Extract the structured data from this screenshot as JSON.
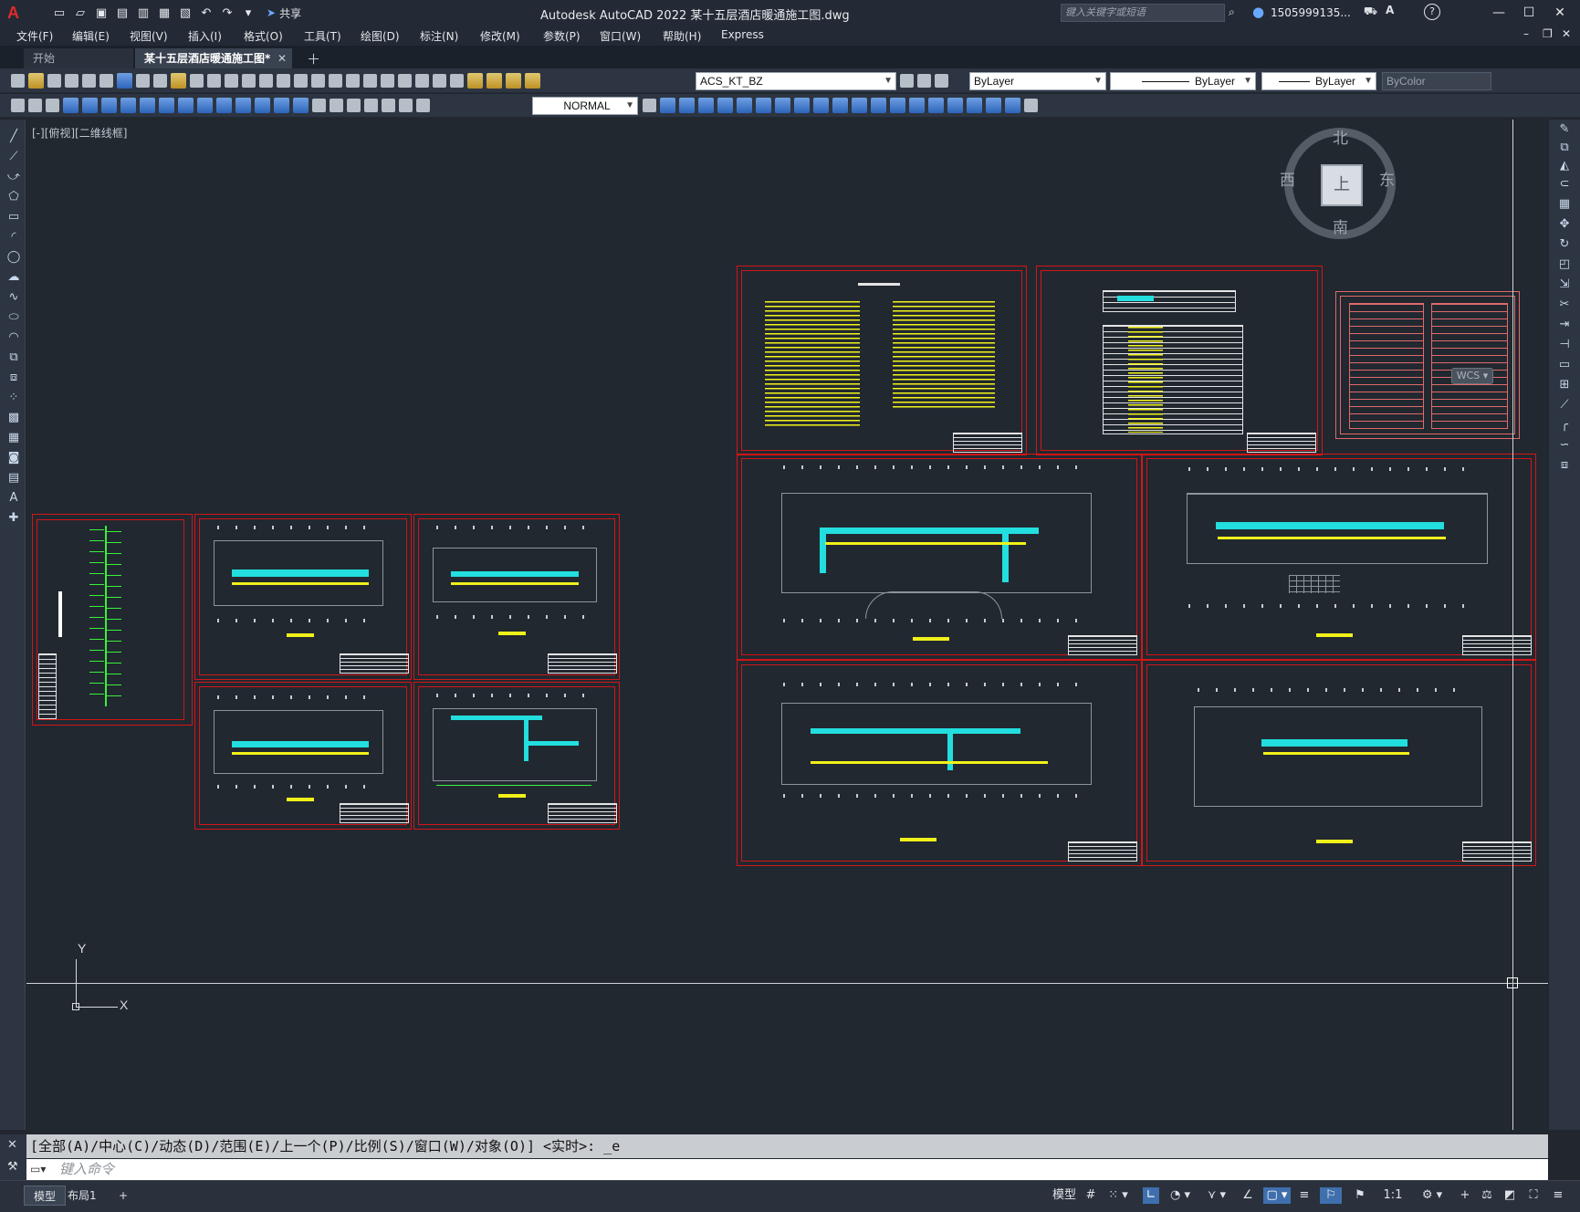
{
  "app": {
    "title": "Autodesk AutoCAD 2022    某十五层酒店暖通施工图.dwg",
    "share_label": "共享",
    "search_placeholder": "键入关键字或短语",
    "user_name": "1505999135..."
  },
  "menu": [
    "文件(F)",
    "编辑(E)",
    "视图(V)",
    "插入(I)",
    "格式(O)",
    "工具(T)",
    "绘图(D)",
    "标注(N)",
    "修改(M)",
    "参数(P)",
    "窗口(W)",
    "帮助(H)",
    "Express"
  ],
  "tabs": {
    "start": "开始",
    "active": "某十五层酒店暖通施工图*"
  },
  "toolbars": {
    "layer": "ACS_KT_BZ",
    "color": "ByLayer",
    "linetype": "ByLayer",
    "lineweight": "ByLayer",
    "plotstyle": "ByColor",
    "dimstyle": "NORMAL"
  },
  "viewport_label": "[-][俯视][二维线框]",
  "viewcube": {
    "face": "上",
    "north": "北",
    "south": "南",
    "east": "东",
    "west": "西",
    "wcs": "WCS"
  },
  "ucs": {
    "x": "X",
    "y": "Y"
  },
  "command": {
    "history": "[全部(A)/中心(C)/动态(D)/范围(E)/上一个(P)/比例(S)/窗口(W)/对象(O)] <实时>: _e",
    "placeholder": "键入命令"
  },
  "status": {
    "layouts": [
      "模型",
      "布局1"
    ],
    "model_label": "模型",
    "scale": "1:1"
  },
  "colors": {
    "sheet_border": "#d31515",
    "duct": "#23dede",
    "annotation": "#f1f11a",
    "canvas": "#212830"
  }
}
